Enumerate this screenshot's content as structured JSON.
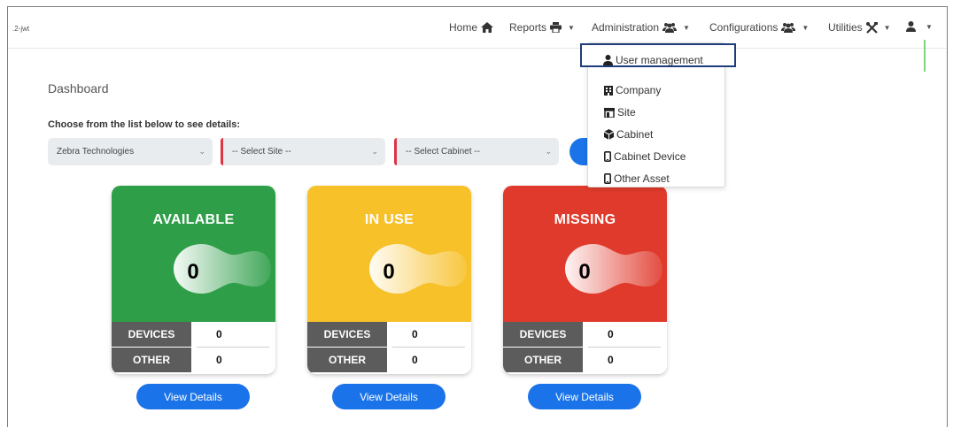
{
  "navbar": {
    "brand": ".2-jwt",
    "items": [
      {
        "label": "Home",
        "icon": "home-icon"
      },
      {
        "label": "Reports",
        "icon": "print-icon"
      },
      {
        "label": "Administration",
        "icon": "users-icon"
      },
      {
        "label": "Configurations",
        "icon": "users-icon"
      },
      {
        "label": "Utilities",
        "icon": "tools-icon"
      },
      {
        "label": "",
        "icon": "user-icon"
      }
    ]
  },
  "dropdown": {
    "items": [
      {
        "label": "User management",
        "icon": "user-icon"
      },
      {
        "label": "Company",
        "icon": "building-icon"
      },
      {
        "label": "Site",
        "icon": "store-icon"
      },
      {
        "label": "Cabinet",
        "icon": "cube-icon"
      },
      {
        "label": "Cabinet Device",
        "icon": "mobile-icon"
      },
      {
        "label": "Other Asset",
        "icon": "mobile-icon"
      }
    ]
  },
  "main": {
    "title": "Dashboard",
    "choose_label": "Choose from the list below to see details:",
    "selects": {
      "company": "Zebra Technologies",
      "site": "-- Select Site --",
      "cabinet": "-- Select Cabinet --"
    }
  },
  "cards": [
    {
      "title": "AVAILABLE",
      "count": "0",
      "devices_label": "DEVICES",
      "devices": "0",
      "other_label": "OTHER",
      "other": "0",
      "button": "View Details",
      "color": "#2e9e48"
    },
    {
      "title": "IN USE",
      "count": "0",
      "devices_label": "DEVICES",
      "devices": "0",
      "other_label": "OTHER",
      "other": "0",
      "button": "View Details",
      "color": "#f7c12a"
    },
    {
      "title": "MISSING",
      "count": "0",
      "devices_label": "DEVICES",
      "devices": "0",
      "other_label": "OTHER",
      "other": "0",
      "button": "View Details",
      "color": "#e03a2c"
    }
  ],
  "colors": {
    "primary": "#1a73e8",
    "highlight_border": "#1f3c7a",
    "required": "#dc3545",
    "label_bg": "#5c5c5c"
  }
}
